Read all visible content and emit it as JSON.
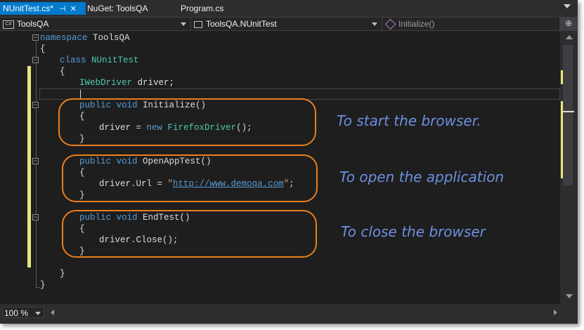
{
  "tabs": [
    {
      "label": "NUnitTest.cs*",
      "active": true
    },
    {
      "label": "NuGet: ToolsQA",
      "active": false
    },
    {
      "label": "Program.cs",
      "active": false
    }
  ],
  "navbar": {
    "project": "ToolsQA",
    "type": "ToolsQA.NUnitTest",
    "member": "Initialize()",
    "project_icon_text": "C#"
  },
  "code": {
    "ns_kw": "namespace",
    "ns_name": " ToolsQA",
    "open_brace": "{",
    "close_brace": "}",
    "class_kw": "class",
    "class_name": " NUnitTest",
    "field_type": "IWebDriver",
    "field_rest": " driver;",
    "m1_mod": "public void",
    "m1_name": " Initialize()",
    "m1_body_a": "driver = ",
    "m1_new": "new",
    "m1_type": " FirefoxDriver",
    "m1_body_b": "();",
    "m2_mod": "public void",
    "m2_name": " OpenAppTest()",
    "m2_body_a": "driver.Url = ",
    "m2_q1": "\"",
    "m2_url": "http://www.demoqa.com",
    "m2_q2": "\"",
    "m2_body_b": ";",
    "m3_mod": "public void",
    "m3_name": " EndTest()",
    "m3_body": "driver.Close();"
  },
  "annotations": {
    "start": "To start the browser.",
    "open": "To open the application",
    "close": "To close the browser"
  },
  "status": {
    "zoom": "100 %"
  },
  "colors": {
    "accent": "#007acc",
    "keyword": "#569cd6",
    "type": "#4ec9b0",
    "string": "#d69d85",
    "bubble": "#e87f1c",
    "annotation": "#6d8fe0"
  }
}
